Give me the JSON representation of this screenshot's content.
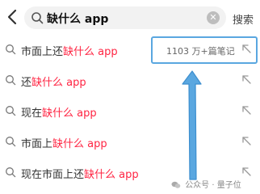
{
  "search": {
    "query": "缺什么 app",
    "button_label": "搜索"
  },
  "suggestions": [
    {
      "prefix": "市面上还",
      "highlight": "缺什么 app"
    },
    {
      "prefix": "还",
      "highlight": "缺什么 app"
    },
    {
      "prefix": "现在",
      "highlight": "缺什么 app"
    },
    {
      "prefix": "市面上",
      "highlight": "缺什么 app"
    },
    {
      "prefix": "现在市面上还",
      "highlight": "缺什么 app"
    }
  ],
  "first_suggestion_meta": "1103 万+篇笔记",
  "watermark": "公众号 · 量子位",
  "colors": {
    "highlight": "#ff2442",
    "annotation": "#5aa7e0"
  }
}
